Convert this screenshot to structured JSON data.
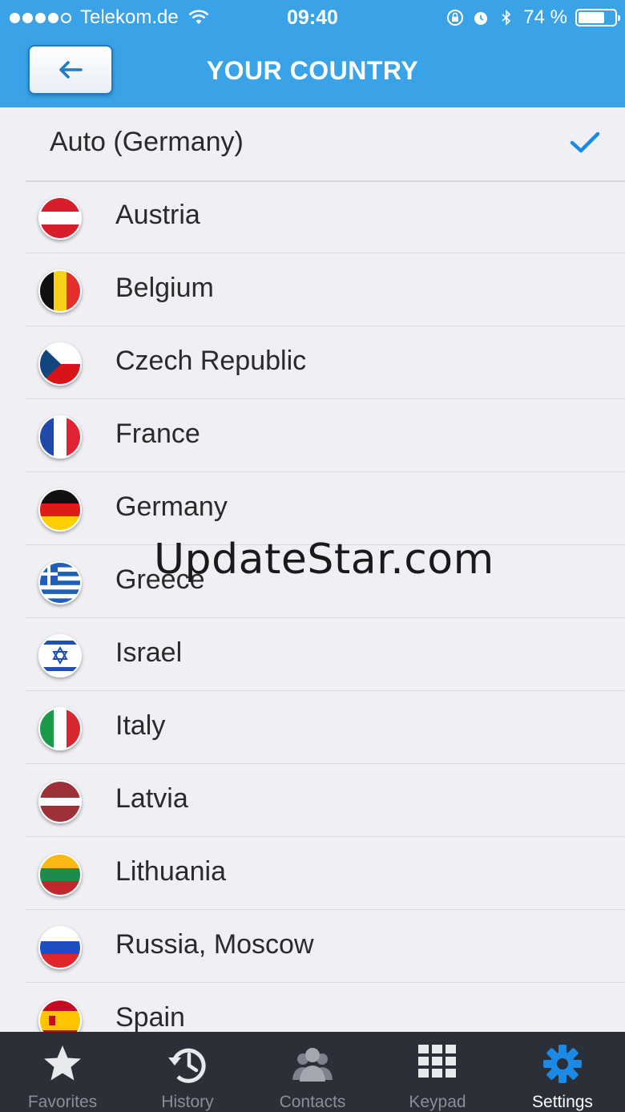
{
  "status_bar": {
    "carrier": "Telekom.de",
    "time": "09:40",
    "battery_text": "74 %",
    "battery_level": 0.74
  },
  "nav": {
    "title": "YOUR COUNTRY",
    "back_icon": "arrow-left-icon"
  },
  "auto_option": {
    "label": "Auto (Germany)",
    "selected": true
  },
  "countries": [
    {
      "name": "Austria",
      "flag": "austria-flag-icon"
    },
    {
      "name": "Belgium",
      "flag": "belgium-flag-icon"
    },
    {
      "name": "Czech Republic",
      "flag": "czech-flag-icon"
    },
    {
      "name": "France",
      "flag": "france-flag-icon"
    },
    {
      "name": "Germany",
      "flag": "germany-flag-icon"
    },
    {
      "name": "Greece",
      "flag": "greece-flag-icon"
    },
    {
      "name": "Israel",
      "flag": "israel-flag-icon"
    },
    {
      "name": "Italy",
      "flag": "italy-flag-icon"
    },
    {
      "name": "Latvia",
      "flag": "latvia-flag-icon"
    },
    {
      "name": "Lithuania",
      "flag": "lithuania-flag-icon"
    },
    {
      "name": "Russia, Moscow",
      "flag": "russia-flag-icon"
    },
    {
      "name": "Spain",
      "flag": "spain-flag-icon"
    }
  ],
  "watermark": "UpdateStar.com",
  "tabs": [
    {
      "label": "Favorites",
      "icon": "star-icon",
      "active": false
    },
    {
      "label": "History",
      "icon": "history-clock-icon",
      "active": false
    },
    {
      "label": "Contacts",
      "icon": "contacts-people-icon",
      "active": false
    },
    {
      "label": "Keypad",
      "icon": "keypad-grid-icon",
      "active": false
    },
    {
      "label": "Settings",
      "icon": "gear-icon",
      "active": true
    }
  ],
  "colors": {
    "header": "#3aa3e8",
    "accent": "#1a8ae6",
    "tabbar": "#2b2f38"
  }
}
